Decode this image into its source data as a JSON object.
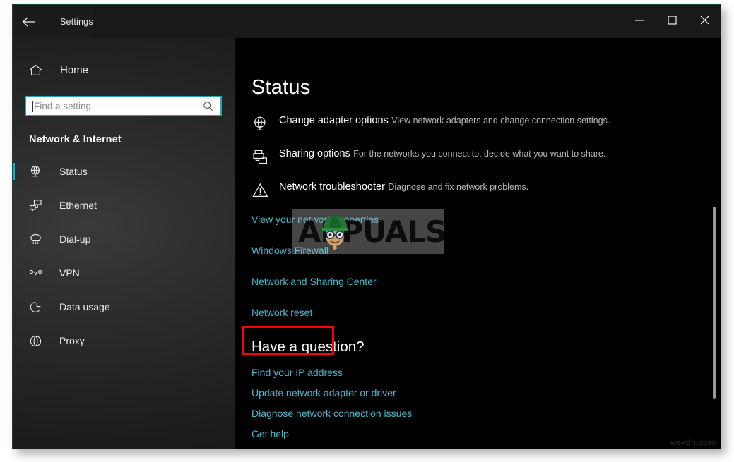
{
  "window": {
    "titlebar": {
      "back_label": "back-arrow",
      "title": "Settings",
      "minimize": "minimize",
      "maximize": "maximize",
      "close": "close"
    },
    "accent_color": "#00b5cc",
    "link_color": "#4bb8cf",
    "highlight_color": "#ff0000"
  },
  "sidebar": {
    "home_label": "Home",
    "search": {
      "placeholder": "Find a setting",
      "value": ""
    },
    "category": "Network & Internet",
    "items": [
      {
        "label": "Status",
        "icon": "globe-monitor-icon",
        "selected": true
      },
      {
        "label": "Ethernet",
        "icon": "ethernet-icon",
        "selected": false
      },
      {
        "label": "Dial-up",
        "icon": "dialup-icon",
        "selected": false
      },
      {
        "label": "VPN",
        "icon": "vpn-icon",
        "selected": false
      },
      {
        "label": "Data usage",
        "icon": "pie-chart-icon",
        "selected": false
      },
      {
        "label": "Proxy",
        "icon": "globe-icon",
        "selected": false
      }
    ]
  },
  "main": {
    "title": "Status",
    "actions": [
      {
        "title": "Change adapter options",
        "subtitle": "View network adapters and change connection settings.",
        "icon": "globe-monitor-icon"
      },
      {
        "title": "Sharing options",
        "subtitle": "For the networks you connect to, decide what you want to share.",
        "icon": "sharing-icon"
      },
      {
        "title": "Network troubleshooter",
        "subtitle": "Diagnose and fix network problems.",
        "icon": "warning-triangle-icon"
      }
    ],
    "links": [
      "View your network properties",
      "Windows Firewall",
      "Network and Sharing Center"
    ],
    "highlighted_link": "Network reset",
    "question_title": "Have a question?",
    "question_links": [
      "Find your IP address",
      "Update network adapter or driver",
      "Diagnose network connection issues",
      "Get help"
    ]
  },
  "watermark": {
    "brand": "APPUALS",
    "corner": "wsxdn.com"
  }
}
